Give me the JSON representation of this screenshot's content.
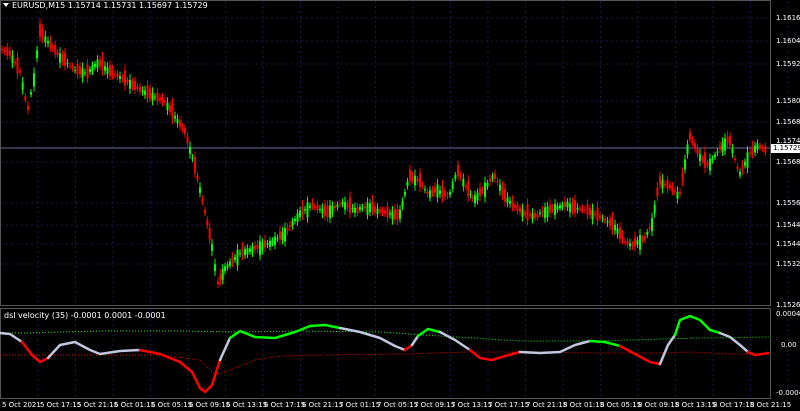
{
  "chart": {
    "symbol": "EURUSD,M15",
    "ohlc": [
      "1.15714",
      "1.15731",
      "1.15697",
      "1.15729"
    ],
    "current_price": "1.15729",
    "price_axis": [
      "1.16165",
      "1.16045",
      "1.15925",
      "1.15805",
      "1.15685",
      "1.15565",
      "1.15445",
      "1.15325",
      "1.15265"
    ],
    "extra_price_label": "1.15745",
    "time_axis": [
      "5 Oct 2021",
      "5 Oct 17:15",
      "5 Oct 21:15",
      "6 Oct 01:15",
      "6 Oct 05:15",
      "6 Oct 09:15",
      "6 Oct 13:15",
      "6 Oct 17:15",
      "6 Oct 21:15",
      "7 Oct 01:15",
      "7 Oct 05:15",
      "7 Oct 09:15",
      "7 Oct 13:15",
      "7 Oct 17:15",
      "7 Oct 21:15",
      "8 Oct 01:15",
      "8 Oct 05:15",
      "8 Oct 09:15",
      "8 Oct 13:15",
      "8 Oct 17:15",
      "8 Oct 21:15"
    ]
  },
  "indicator": {
    "name": "dsl velocity (35)",
    "values": [
      "-0.0001",
      "0.0001",
      "-0.0001"
    ],
    "axis": [
      "0.0004",
      "0.00",
      "-0.0004"
    ]
  },
  "colors": {
    "background": "#000000",
    "bull": "#00ff00",
    "bear": "#ff0000",
    "neutral_line": "#c0c8e0",
    "grid": "#1a1a4a"
  }
}
